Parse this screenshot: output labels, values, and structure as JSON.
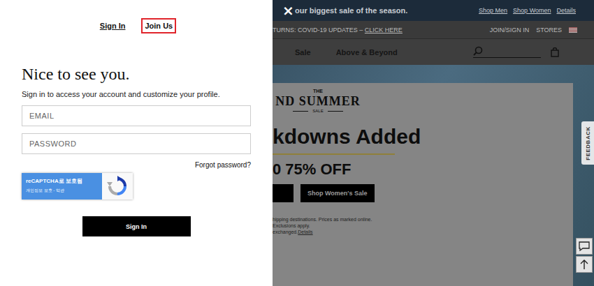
{
  "modal": {
    "close": "×",
    "tabs": [
      {
        "label": "Sign In",
        "selected": true,
        "highlighted": false
      },
      {
        "label": "Join Us",
        "selected": false,
        "highlighted": true
      }
    ],
    "title": "Nice to see you.",
    "subtitle": "Sign in to access your account and customize your profile.",
    "fields": [
      {
        "placeholder": "EMAIL",
        "type": "email"
      },
      {
        "placeholder": "PASSWORD",
        "type": "password"
      }
    ],
    "forgot": "Forgot password?",
    "recaptcha": {
      "title": "reCAPTCHA로 보호됨",
      "links": "개인정보 보호 - 약관"
    },
    "submit": "Sign In"
  },
  "page": {
    "banner": {
      "text": "our biggest sale of the season.",
      "links": [
        "Shop Men",
        "Shop Women",
        "Details"
      ]
    },
    "utility": {
      "text": "TURNS: COVID-19 UPDATES –",
      "link": "CLICK HERE",
      "right": [
        "JOIN/SIGN IN",
        "STORES"
      ]
    },
    "nav": [
      "Sale",
      "Above & Beyond"
    ],
    "hero": {
      "eyebrow": "THE",
      "title": "ND SUMMER",
      "tag": "SALE",
      "headline": "kdowns Added",
      "offer": "0 75% OFF",
      "buttons": [
        "",
        "Shop Women's Sale"
      ],
      "fine_print": [
        "hipping destinations. Prices as marked online.",
        "Exclusions apply.",
        "exchanged."
      ],
      "fine_link": "Details"
    },
    "feedback": "FEEDBACK"
  }
}
